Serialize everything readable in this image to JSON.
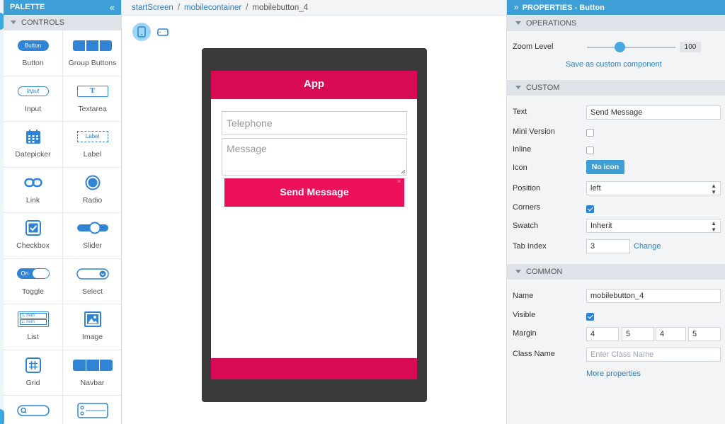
{
  "palette": {
    "title": "PALETTE",
    "collapse_icon": "double-chevron-left-icon",
    "section": "CONTROLS",
    "controls": [
      {
        "label": "Button",
        "icon": "button-icon",
        "icon_text": "Button"
      },
      {
        "label": "Group Buttons",
        "icon": "group-buttons-icon"
      },
      {
        "label": "Input",
        "icon": "input-icon",
        "icon_text": "Input"
      },
      {
        "label": "Textarea",
        "icon": "textarea-icon",
        "icon_text": "T"
      },
      {
        "label": "Datepicker",
        "icon": "calendar-icon"
      },
      {
        "label": "Label",
        "icon": "label-icon",
        "icon_text": "Label"
      },
      {
        "label": "Link",
        "icon": "link-icon"
      },
      {
        "label": "Radio",
        "icon": "radio-icon"
      },
      {
        "label": "Checkbox",
        "icon": "checkbox-icon"
      },
      {
        "label": "Slider",
        "icon": "slider-icon"
      },
      {
        "label": "Toggle",
        "icon": "toggle-icon",
        "icon_text": "On"
      },
      {
        "label": "Select",
        "icon": "select-icon"
      },
      {
        "label": "List",
        "icon": "list-icon",
        "icon_text": "1. Item",
        "icon_text2": "2. Item"
      },
      {
        "label": "Image",
        "icon": "image-icon"
      },
      {
        "label": "Grid",
        "icon": "grid-icon"
      },
      {
        "label": "Navbar",
        "icon": "navbar-icon"
      },
      {
        "label": "",
        "icon": "search-field-icon"
      },
      {
        "label": "",
        "icon": "collapsible-list-icon"
      }
    ]
  },
  "breadcrumb": {
    "items": [
      "startScreen",
      "mobilecontainer",
      "mobilebutton_4"
    ]
  },
  "device": {
    "portrait_icon": "phone-portrait-icon",
    "landscape_icon": "phone-landscape-icon"
  },
  "app": {
    "header_title": "App",
    "telephone_placeholder": "Telephone",
    "message_placeholder": "Message",
    "send_button_label": "Send Message",
    "send_button_close": "✕",
    "accent_color": "#d90a55"
  },
  "properties": {
    "title": "PROPERTIES - Button",
    "expand_icon": "double-chevron-right-icon",
    "operations": {
      "section": "OPERATIONS",
      "zoom_label": "Zoom Level",
      "zoom_value": "100",
      "zoom_fraction": 0.37,
      "save_link": "Save as custom component"
    },
    "custom": {
      "section": "CUSTOM",
      "text_label": "Text",
      "text_value": "Send Message",
      "mini_label": "Mini Version",
      "mini_checked": false,
      "inline_label": "Inline",
      "inline_checked": false,
      "icon_label": "Icon",
      "icon_button": "No icon",
      "position_label": "Position",
      "position_value": "left",
      "corners_label": "Corners",
      "corners_checked": true,
      "swatch_label": "Swatch",
      "swatch_value": "Inherit",
      "tabindex_label": "Tab Index",
      "tabindex_value": "3",
      "change_link": "Change"
    },
    "common": {
      "section": "COMMON",
      "name_label": "Name",
      "name_value": "mobilebutton_4",
      "visible_label": "Visible",
      "visible_checked": true,
      "margin_label": "Margin",
      "margin_values": [
        "4",
        "5",
        "4",
        "5"
      ],
      "class_label": "Class Name",
      "class_placeholder": "Enter Class Name",
      "more_link": "More properties"
    }
  }
}
